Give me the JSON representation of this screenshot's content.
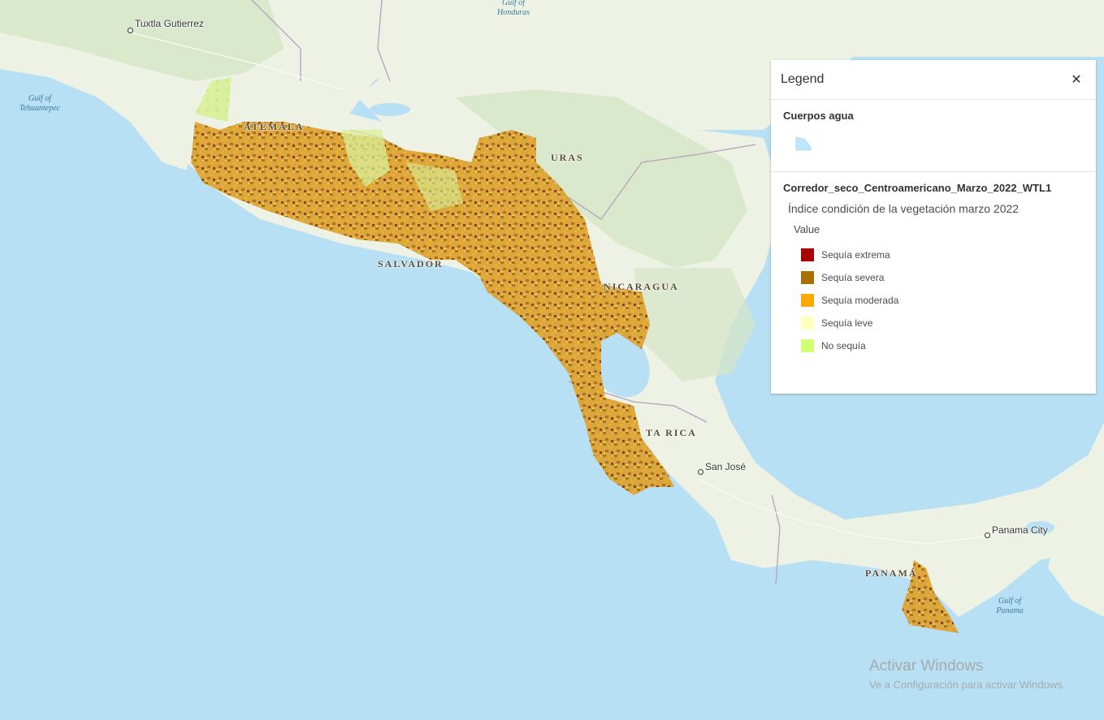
{
  "colors": {
    "ocean": "#b8e0f4",
    "land": "#eef2e4",
    "sequia_extrema": "#a80000",
    "sequia_severa": "#a87000",
    "sequia_moderada": "#ffaa00",
    "sequia_leve": "#ffffbe",
    "no_sequia": "#d1ff73",
    "water_swatch": "#bee8ff"
  },
  "map": {
    "country_labels": [
      "ATEMALA",
      "URAS",
      "SALVADOR",
      "NICARAGUA",
      "TA RICA",
      "PANAMÁ"
    ],
    "water_labels": {
      "tehuantepec": "Gulf of\nTehuantepec",
      "honduras": "Gulf of\nHonduras",
      "panama": "Gulf of\nPanama"
    },
    "cities": [
      "Tuxtla Gutierrez",
      "San José",
      "Panama City"
    ]
  },
  "legend": {
    "title": "Legend",
    "close_icon": "close-icon",
    "layer1_title": "Cuerpos agua",
    "layer2_title": "Corredor_seco_Centroamericano_Marzo_2022_WTL1",
    "field_name": "Índice condición de la vegetación marzo 2022",
    "value_label": "Value",
    "items": [
      {
        "label": "Sequía extrema"
      },
      {
        "label": "Sequía severa"
      },
      {
        "label": "Sequía moderada"
      },
      {
        "label": "Sequía leve"
      },
      {
        "label": "No sequía"
      }
    ]
  },
  "watermark": {
    "title": "Activar Windows",
    "subtitle": "Ve a Configuración para activar Windows."
  }
}
